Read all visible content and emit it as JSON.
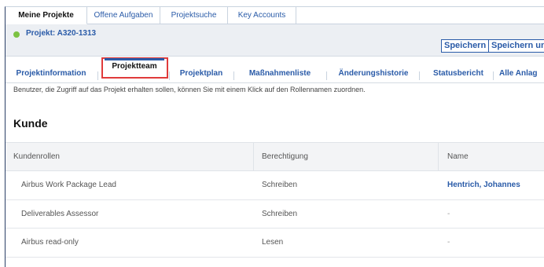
{
  "top_tabs": [
    {
      "label": "Meine Projekte",
      "active": true
    },
    {
      "label": "Offene Aufgaben",
      "active": false
    },
    {
      "label": "Projektsuche",
      "active": false
    },
    {
      "label": "Key Accounts",
      "active": false
    }
  ],
  "project": {
    "title": "Projekt: A320-1313",
    "status_color": "#7cc242",
    "save_label": "Speichern",
    "save_and_label": "Speichern un"
  },
  "sub_nav": [
    {
      "label": "Projektinformation"
    },
    {
      "label": "Projektteam",
      "active": true
    },
    {
      "label": "Projektplan"
    },
    {
      "label": "Maßnahmenliste"
    },
    {
      "label": "Änderungshistorie"
    },
    {
      "label": "Statusbericht"
    },
    {
      "label": "Alle Anlag"
    }
  ],
  "info_text": "Benutzer, die Zugriff auf das Projekt erhalten sollen, können Sie mit einem Klick auf den Rollennamen zuordnen.",
  "section_title": "Kunde",
  "table": {
    "headers": [
      "Kundenrollen",
      "Berechtigung",
      "Name"
    ],
    "rows": [
      {
        "role": "Airbus Work Package Lead",
        "permission": "Schreiben",
        "name": "Hentrich, Johannes"
      },
      {
        "role": "Deliverables Assessor",
        "permission": "Schreiben",
        "name": "-"
      },
      {
        "role": "Airbus read-only",
        "permission": "Lesen",
        "name": "-"
      }
    ]
  },
  "colors": {
    "accent": "#2a5ba8",
    "highlight": "#e03b3b"
  }
}
